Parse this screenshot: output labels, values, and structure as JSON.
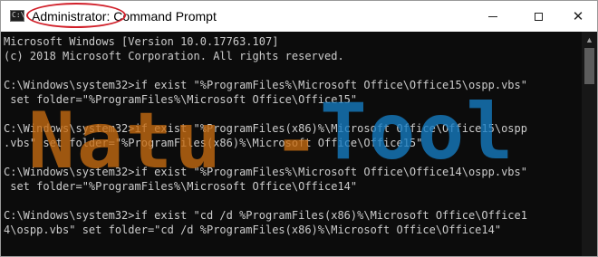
{
  "window": {
    "title_highlight": "Administrator:",
    "title_rest": " Command Prompt",
    "app_icon_text": "C:\\",
    "controls": {
      "minimize": "minimize-icon",
      "maximize": "maximize-icon",
      "close": "close-icon"
    }
  },
  "console": {
    "lines": [
      "Microsoft Windows [Version 10.0.17763.107]",
      "(c) 2018 Microsoft Corporation. All rights reserved.",
      "",
      "C:\\Windows\\system32>if exist \"%ProgramFiles%\\Microsoft Office\\Office15\\ospp.vbs\"",
      " set folder=\"%ProgramFiles%\\Microsoft Office\\Office15\"",
      "",
      "C:\\Windows\\system32>if exist \"%ProgramFiles(x86)%\\Microsoft Office\\Office15\\ospp",
      ".vbs\" set folder=\"%ProgramFiles(x86)%\\Microsoft Office\\Office15\"",
      "",
      "C:\\Windows\\system32>if exist \"%ProgramFiles%\\Microsoft Office\\Office14\\ospp.vbs\"",
      " set folder=\"%ProgramFiles%\\Microsoft Office\\Office14\"",
      "",
      "C:\\Windows\\system32>if exist \"cd /d %ProgramFiles(x86)%\\Microsoft Office\\Office1",
      "4\\ospp.vbs\" set folder=\"cd /d %ProgramFiles(x86)%\\Microsoft Office\\Office14\""
    ]
  },
  "watermark": {
    "part1": "Natu",
    "dash": "-",
    "part2": "Tool"
  },
  "colors": {
    "console_bg": "#0c0c0c",
    "console_text": "#cccccc",
    "title_highlight_ring": "#d1202a",
    "watermark_orange": "#c86d12",
    "watermark_blue": "#167dc4"
  }
}
